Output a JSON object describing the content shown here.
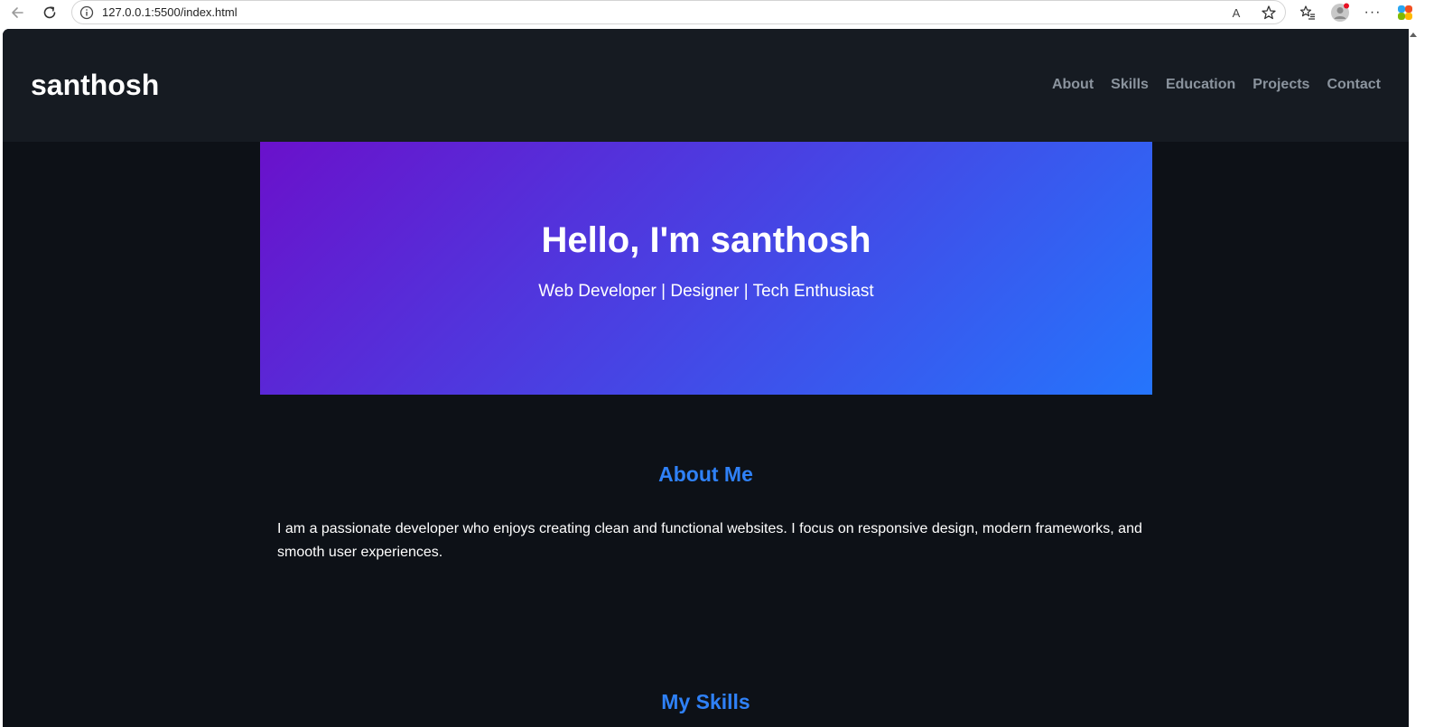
{
  "browser": {
    "url": "127.0.0.1:5500/index.html",
    "read_aloud_label": "A",
    "more_label": "···"
  },
  "site": {
    "logo": "santhosh",
    "nav": [
      "About",
      "Skills",
      "Education",
      "Projects",
      "Contact"
    ]
  },
  "hero": {
    "title": "Hello, I'm santhosh",
    "subtitle": "Web Developer | Designer | Tech Enthusiast",
    "gradient_start": "#6a11cb",
    "gradient_end": "#2575fc"
  },
  "about": {
    "title": "About Me",
    "text": "I am a passionate developer who enjoys creating clean and functional websites. I focus on responsive design, modern frameworks, and smooth user experiences."
  },
  "skills": {
    "title": "My Skills"
  },
  "colors": {
    "page_bg": "#0d1117",
    "header_bg": "#161b22",
    "accent": "#2f81f7",
    "nav_text": "#8b949e"
  }
}
